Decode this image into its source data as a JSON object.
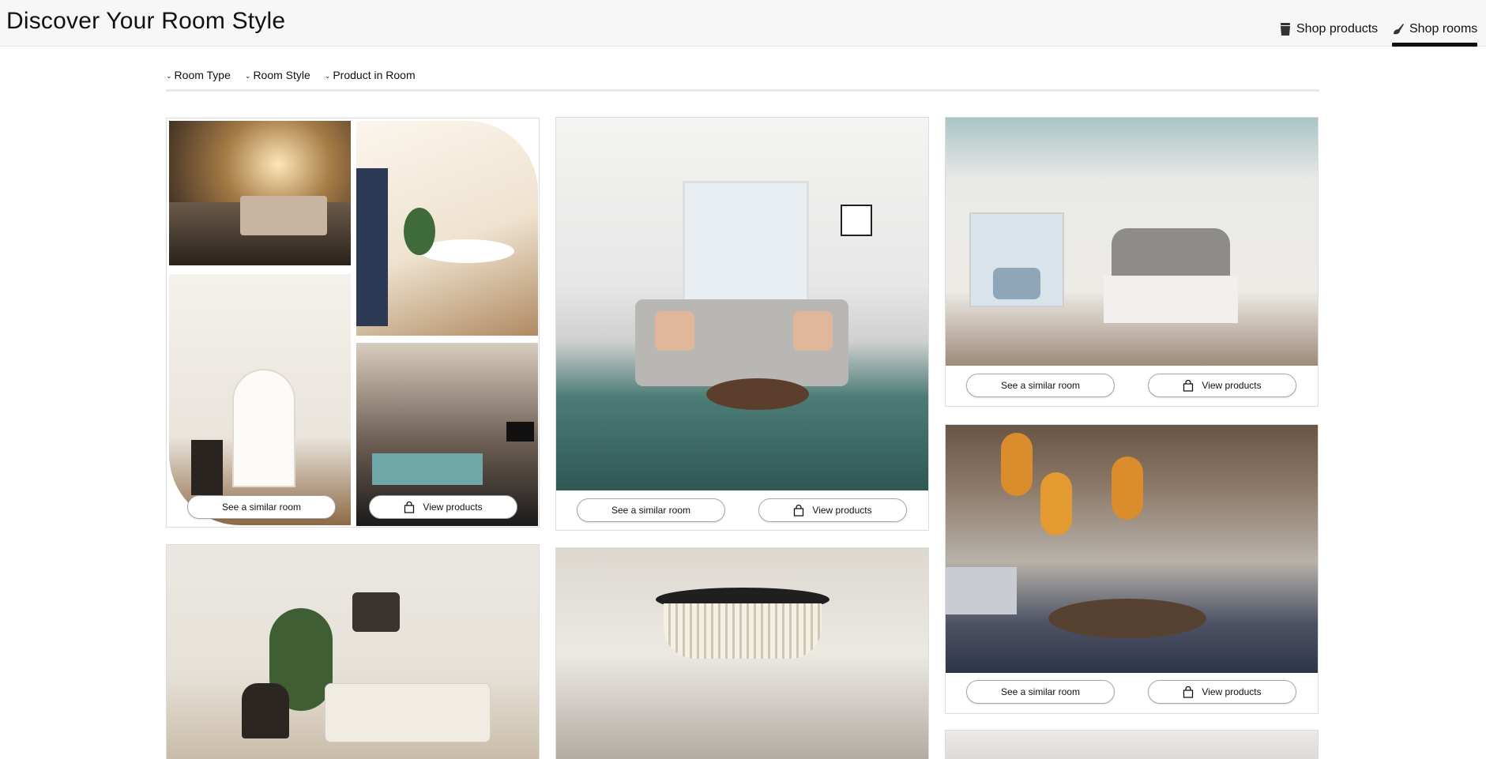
{
  "header": {
    "title": "Discover Your Room Style",
    "tabs": [
      {
        "label": "Shop products",
        "icon": "bucket-icon"
      },
      {
        "label": "Shop rooms",
        "icon": "paint-brush-icon",
        "active": true
      }
    ]
  },
  "filters": [
    {
      "label": "Room Type"
    },
    {
      "label": "Room Style"
    },
    {
      "label": "Product in Room"
    }
  ],
  "buttons": {
    "similar": "See a similar room",
    "products": "View products"
  },
  "colors": {
    "header_bg": "#f7f7f7",
    "active_tab": "#111111",
    "border": "#dcdcdc"
  }
}
